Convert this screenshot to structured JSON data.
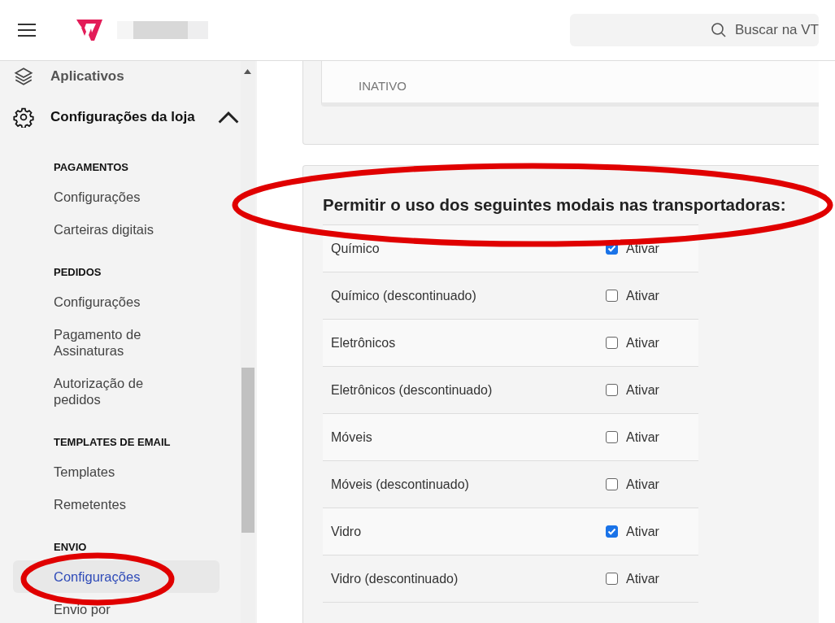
{
  "header": {
    "search": {
      "placeholder": "Buscar na VT"
    }
  },
  "sidebar": {
    "items": [
      {
        "label": "Aplicativos",
        "kind": "apps",
        "expanded": false
      },
      {
        "label": "Configurações da loja",
        "kind": "settings",
        "expanded": true,
        "sections": [
          {
            "title": "PAGAMENTOS",
            "items": [
              {
                "label": "Configurações",
                "selected": false
              },
              {
                "label": "Carteiras digitais",
                "selected": false
              }
            ]
          },
          {
            "title": "PEDIDOS",
            "items": [
              {
                "label": "Configurações",
                "selected": false
              },
              {
                "label": "Pagamento de Assinaturas",
                "selected": false
              },
              {
                "label": "Autorização de pedidos",
                "selected": false
              }
            ]
          },
          {
            "title": "TEMPLATES DE EMAIL",
            "items": [
              {
                "label": "Templates",
                "selected": false
              },
              {
                "label": "Remetentes",
                "selected": false
              }
            ]
          },
          {
            "title": "ENVIO",
            "items": [
              {
                "label": "Configurações",
                "selected": true
              },
              {
                "label": "Envio por",
                "selected": false
              }
            ]
          }
        ]
      }
    ]
  },
  "top_card": {
    "status": "INATIVO"
  },
  "modals": {
    "heading": "Permitir o uso dos seguintes modais nas transportadoras:",
    "rows": [
      {
        "name": "Químico",
        "label": "Ativar",
        "checked": true
      },
      {
        "name": "Químico (descontinuado)",
        "label": "Ativar",
        "checked": false
      },
      {
        "name": "Eletrônicos",
        "label": "Ativar",
        "checked": false
      },
      {
        "name": "Eletrônicos (descontinuado)",
        "label": "Ativar",
        "checked": false
      },
      {
        "name": "Móveis",
        "label": "Ativar",
        "checked": false
      },
      {
        "name": "Móveis (descontinuado)",
        "label": "Ativar",
        "checked": false
      },
      {
        "name": "Vidro",
        "label": "Ativar",
        "checked": true
      },
      {
        "name": "Vidro (descontinuado)",
        "label": "Ativar",
        "checked": false
      }
    ]
  },
  "annotations": [
    {
      "kind": "ellipse"
    },
    {
      "kind": "ellipse"
    }
  ]
}
